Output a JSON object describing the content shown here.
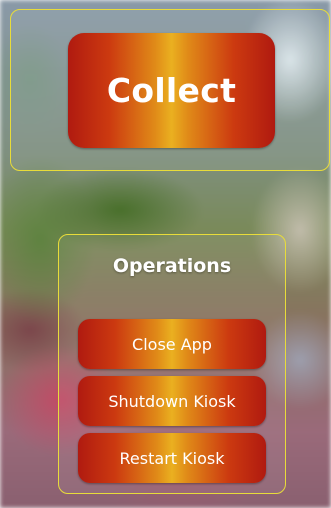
{
  "collect": {
    "label": "Collect"
  },
  "operations": {
    "title": "Operations",
    "buttons": [
      {
        "label": "Close App"
      },
      {
        "label": "Shutdown Kiosk"
      },
      {
        "label": "Restart Kiosk"
      }
    ]
  },
  "colors": {
    "panel_border": "#e8dc3a",
    "button_edge": "#b01a10",
    "button_center": "#eab020",
    "text": "#ffffff"
  }
}
